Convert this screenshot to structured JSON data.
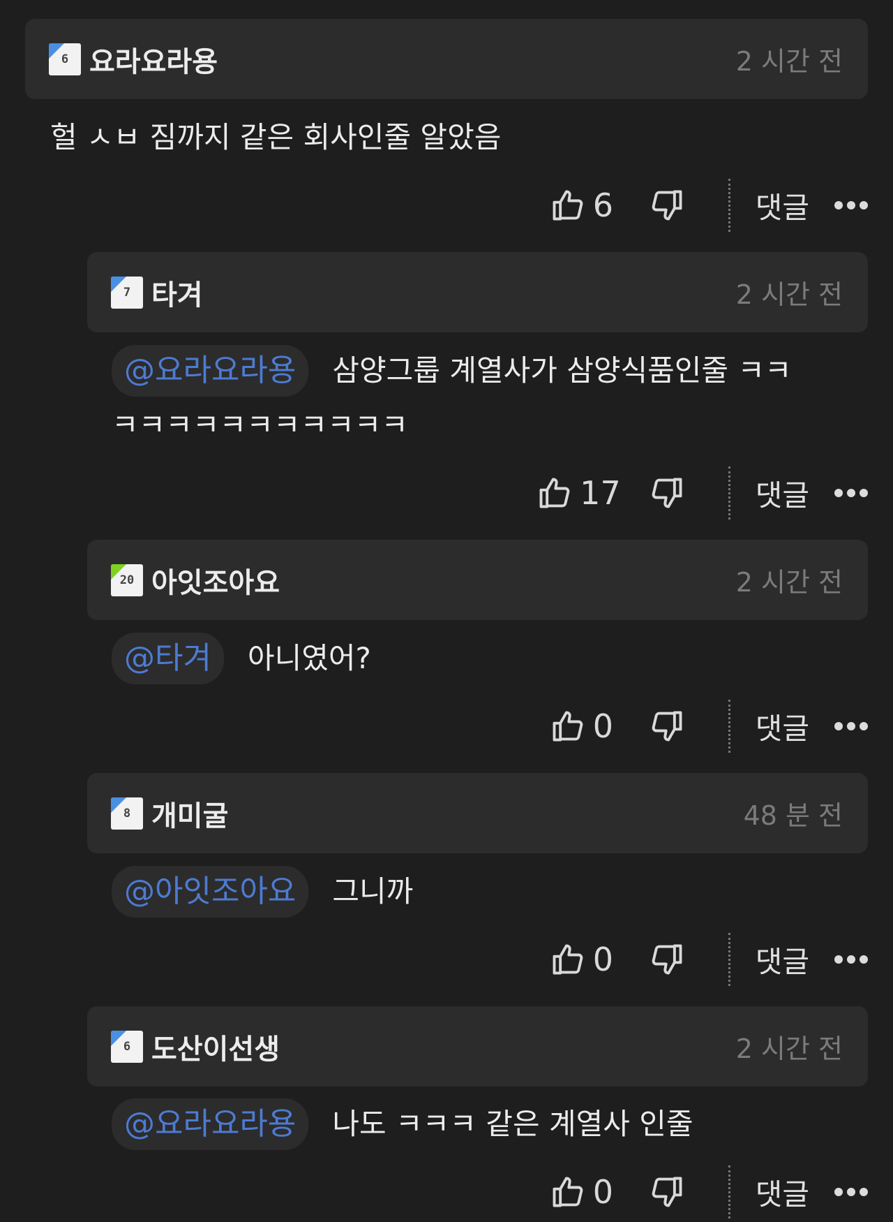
{
  "reply_label": "댓글",
  "comments": [
    {
      "author": "요라요라용",
      "level": "6",
      "level_color": "blue",
      "time": "2 시간 전",
      "mention": "",
      "text": "헐 ㅅㅂ 짐까지 같은 회사인줄 알았음",
      "text2": "",
      "likes": "6"
    },
    {
      "author": "타겨",
      "level": "7",
      "level_color": "blue",
      "time": "2 시간 전",
      "mention": "@요라요라용",
      "text": "삼양그룹 계열사가 삼양식품인줄 ㅋㅋ",
      "text2": "ㅋㅋㅋㅋㅋㅋㅋㅋㅋㅋㅋ",
      "likes": "17"
    },
    {
      "author": "아잇조아요",
      "level": "20",
      "level_color": "green",
      "time": "2 시간 전",
      "mention": "@타겨",
      "text": "아니였어?",
      "text2": "",
      "likes": "0"
    },
    {
      "author": "개미굴",
      "level": "8",
      "level_color": "blue",
      "time": "48 분 전",
      "mention": "@아잇조아요",
      "text": "그니까",
      "text2": "",
      "likes": "0"
    },
    {
      "author": "도산이선생",
      "level": "6",
      "level_color": "blue",
      "time": "2 시간 전",
      "mention": "@요라요라용",
      "text": "나도 ㅋㅋㅋ 같은 계열사 인줄",
      "text2": "",
      "likes": "0"
    }
  ]
}
